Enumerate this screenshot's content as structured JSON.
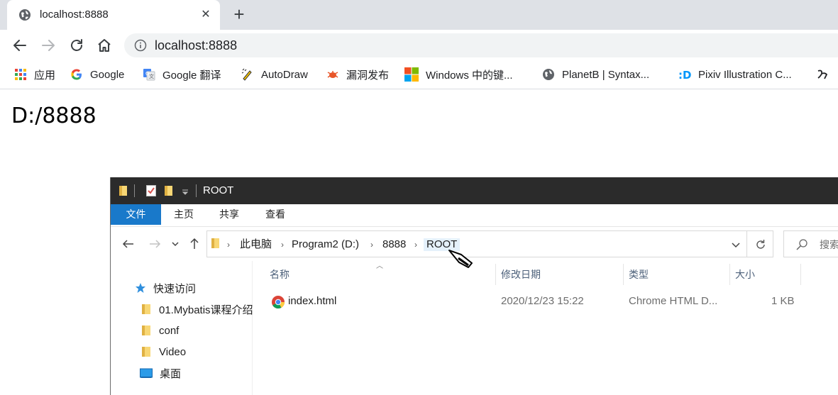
{
  "browser": {
    "tab": {
      "title": "localhost:8888",
      "close": "✕"
    },
    "new_tab": "+",
    "address": "localhost:8888",
    "bookmarks": [
      {
        "label": "应用",
        "icon": "apps-grid-icon"
      },
      {
        "label": "Google",
        "icon": "google-icon"
      },
      {
        "label": "Google 翻译",
        "icon": "google-translate-icon"
      },
      {
        "label": "AutoDraw",
        "icon": "autodraw-icon"
      },
      {
        "label": "漏洞发布",
        "icon": "bug-icon"
      },
      {
        "label": "Windows 中的键...",
        "icon": "windows-icon"
      },
      {
        "label": "PlanetB | Syntax...",
        "icon": "globe-icon"
      },
      {
        "label": "Pixiv Illustration C...",
        "icon": "pixiv-icon"
      }
    ]
  },
  "page": {
    "heading": "D:/8888"
  },
  "explorer": {
    "title": "ROOT",
    "ribbon_tabs": [
      "文件",
      "主页",
      "共享",
      "查看"
    ],
    "breadcrumb": [
      "此电脑",
      "Program2 (D:)",
      "8888",
      "ROOT"
    ],
    "search_placeholder": "搜索",
    "nav_items": [
      {
        "label": "快速访问",
        "icon": "star-icon"
      },
      {
        "label": "01.Mybatis课程介绍",
        "icon": "folder-icon"
      },
      {
        "label": "conf",
        "icon": "folder-icon"
      },
      {
        "label": "Video",
        "icon": "folder-icon"
      },
      {
        "label": "桌面",
        "icon": "desktop-icon"
      }
    ],
    "columns": {
      "name": "名称",
      "modified": "修改日期",
      "type": "类型",
      "size": "大小"
    },
    "files": [
      {
        "name": "index.html",
        "modified": "2020/12/23 15:22",
        "type": "Chrome HTML D...",
        "size": "1 KB",
        "icon": "chrome-icon"
      }
    ]
  },
  "colors": {
    "tabstrip": "#dee1e6",
    "explorer_titlebar": "#2b2b2b",
    "ribbon_active": "#1979ca",
    "column_header_text": "#4c607a"
  }
}
